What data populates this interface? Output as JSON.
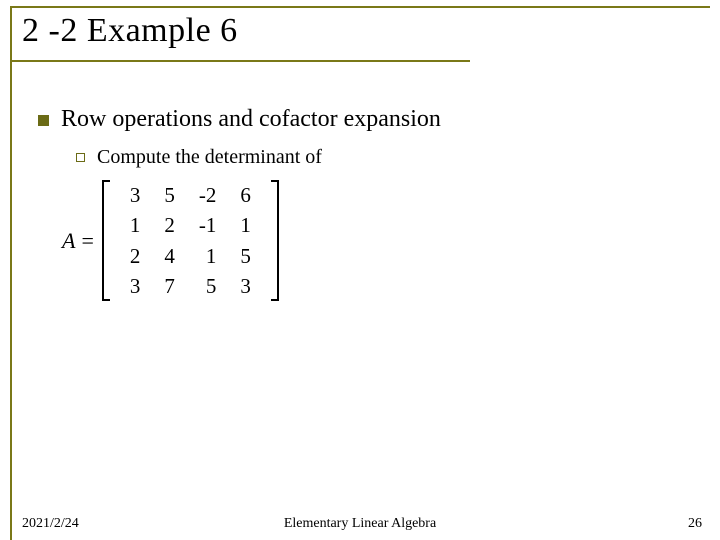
{
  "title": "2 -2 Example 6",
  "bullets": {
    "main": "Row operations and cofactor expansion",
    "sub": "Compute the determinant of"
  },
  "matrix": {
    "lhs": "A",
    "eq": "=",
    "rows": [
      [
        "3",
        "5",
        "-2",
        "6"
      ],
      [
        "1",
        "2",
        "-1",
        "1"
      ],
      [
        "2",
        "4",
        "1",
        "5"
      ],
      [
        "3",
        "7",
        "5",
        "3"
      ]
    ]
  },
  "footer": {
    "date": "2021/2/24",
    "center": "Elementary Linear Algebra",
    "page": "26"
  }
}
